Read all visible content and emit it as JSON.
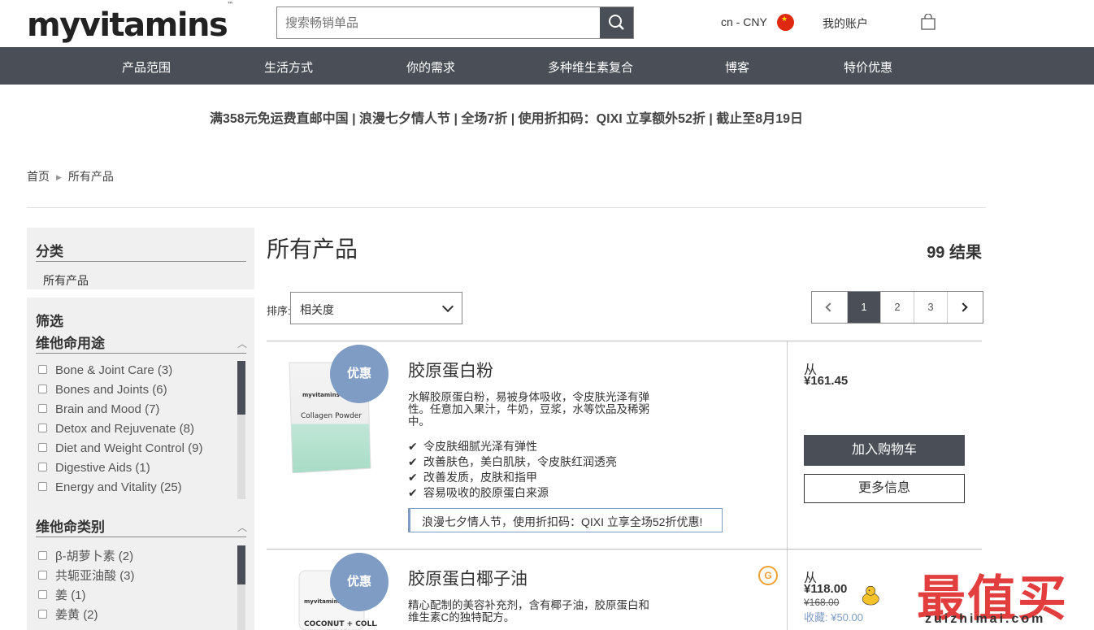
{
  "header": {
    "logo": "myvitamins",
    "logo_tm": "™",
    "search_placeholder": "搜索畅销单品",
    "currency": "cn - CNY",
    "account": "我的账户"
  },
  "nav": [
    "产品范围",
    "生活方式",
    "你的需求",
    "多种维生素复合",
    "博客",
    "特价优惠"
  ],
  "promo": "满358元免运费直邮中国 | 浪漫七夕情人节 | 全场7折 | 使用折扣码：QIXI 立享额外52折 | 截止至8月19日",
  "breadcrumb": {
    "home": "首页",
    "current": "所有产品"
  },
  "sidebar": {
    "category_title": "分类",
    "category_item": "所有产品",
    "filter_title": "筛选",
    "groups": [
      {
        "title": "维他命用途",
        "items": [
          {
            "label": "Bone & Joint Care",
            "count": "(3)"
          },
          {
            "label": "Bones and Joints",
            "count": "(6)"
          },
          {
            "label": "Brain and Mood",
            "count": "(7)"
          },
          {
            "label": "Detox and Rejuvenate",
            "count": "(8)"
          },
          {
            "label": "Diet and Weight Control",
            "count": "(9)"
          },
          {
            "label": "Digestive Aids",
            "count": "(1)"
          },
          {
            "label": "Energy and Vitality",
            "count": "(25)"
          }
        ]
      },
      {
        "title": "维他命类别",
        "items": [
          {
            "label": "β-胡萝卜素",
            "count": "(2)"
          },
          {
            "label": "共轭亚油酸",
            "count": "(3)"
          },
          {
            "label": "姜",
            "count": "(1)"
          },
          {
            "label": "姜黄",
            "count": "(2)"
          }
        ]
      }
    ]
  },
  "main": {
    "title": "所有产品",
    "result_count": "99 结果",
    "sort_label": "排序:",
    "sort_value": "相关度",
    "pages": [
      "1",
      "2",
      "3"
    ],
    "active_page": "1"
  },
  "products": [
    {
      "badge": "优惠",
      "name": "胶原蛋白粉",
      "desc": "水解胶原蛋白粉，易被身体吸收，令皮肤光泽有弹性。任意加入果汁，牛奶，豆浆，水等饮品及稀粥中。",
      "bullets": [
        "令皮肤细腻光泽有弹性",
        "改善肤色，美白肌肤，令皮肤红润透亮",
        "改善发质，皮肤和指甲",
        "容易吸收的胶原蛋白来源"
      ],
      "offer": "浪漫七夕情人节，使用折扣码：QIXI 立享全场52折优惠!",
      "from": "从",
      "price": "¥161.45",
      "add_to_cart": "加入购物车",
      "more_info": "更多信息",
      "pack_brand": "myvitamins",
      "pack_label": "Collagen Powder"
    },
    {
      "badge": "优惠",
      "name": "胶原蛋白椰子油",
      "desc": "精心配制的美容补充剂，含有椰子油，胶原蛋白和维生素C的独特配方。",
      "from": "从",
      "price": "¥118.00",
      "old_price": "¥168.00",
      "save": "收藏: ¥50.00",
      "g_icon": "G",
      "pack_brand": "myvitamins",
      "pack_label": "COCONUT + COLLAGEN"
    }
  ],
  "watermark": {
    "text": "最值买",
    "url": "zuizhimai.com"
  },
  "colors": {
    "nav_bg": "#4a4e57",
    "badge": "#7f9cc5",
    "accent_orange": "#f0a030",
    "watermark_red": "#e33e3e"
  }
}
